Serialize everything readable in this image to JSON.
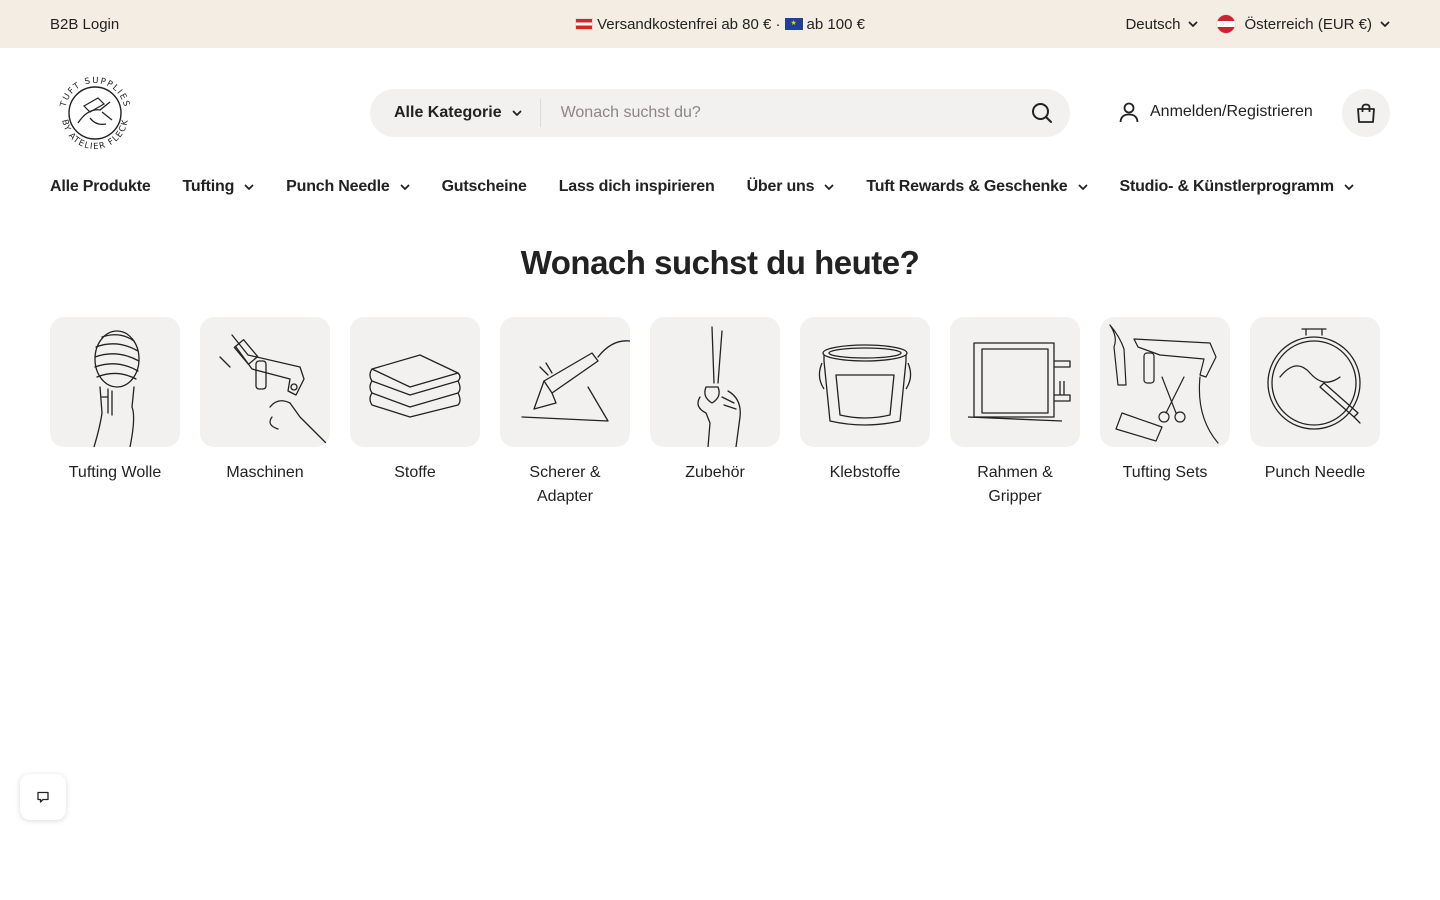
{
  "topbar": {
    "b2b_label": "B2B Login",
    "announce_part1": "Versandkostenfrei ab 80 € ·",
    "announce_part2": "ab 100 €",
    "language": "Deutsch",
    "country": "Österreich (EUR €)"
  },
  "header": {
    "logo_text_top": "TUFT SUPPLIES",
    "logo_text_bottom": "BY ATELIER FLECK",
    "search_category": "Alle Kategorie",
    "search_placeholder": "Wonach suchst du?",
    "account_label": "Anmelden/Registrieren"
  },
  "nav": [
    {
      "label": "Alle Produkte",
      "dropdown": false
    },
    {
      "label": "Tufting",
      "dropdown": true
    },
    {
      "label": "Punch Needle",
      "dropdown": true
    },
    {
      "label": "Gutscheine",
      "dropdown": false
    },
    {
      "label": "Lass dich inspirieren",
      "dropdown": false
    },
    {
      "label": "Über uns",
      "dropdown": true
    },
    {
      "label": "Tuft Rewards & Geschenke",
      "dropdown": true
    },
    {
      "label": "Studio- & Künstlerprogramm",
      "dropdown": true
    }
  ],
  "heading": "Wonach suchst du heute?",
  "categories": [
    {
      "label": "Tufting Wolle",
      "icon": "yarn-hand-icon"
    },
    {
      "label": "Maschinen",
      "icon": "tufting-gun-icon"
    },
    {
      "label": "Stoffe",
      "icon": "fabric-stack-icon"
    },
    {
      "label": "Scherer & Adapter",
      "icon": "shearer-icon"
    },
    {
      "label": "Zubehör",
      "icon": "scissors-hand-icon"
    },
    {
      "label": "Klebstoffe",
      "icon": "glue-bucket-icon"
    },
    {
      "label": "Rahmen & Gripper",
      "icon": "frame-icon"
    },
    {
      "label": "Tufting Sets",
      "icon": "tufting-set-icon"
    },
    {
      "label": "Punch Needle",
      "icon": "embroidery-hoop-icon"
    }
  ],
  "colors": {
    "topbar_bg": "#f4ede3",
    "tile_bg": "#f2f1ef",
    "text": "#222222"
  }
}
